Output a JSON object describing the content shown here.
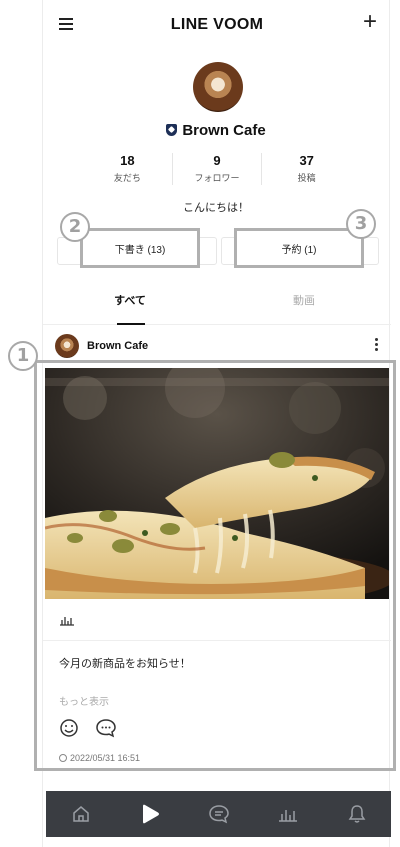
{
  "header": {
    "title": "LINE VOOM",
    "menu_icon": "hamburger-menu-icon",
    "plus_icon": "plus-icon"
  },
  "profile": {
    "name": "Brown Cafe",
    "stats": [
      {
        "value": "18",
        "label": "友だち"
      },
      {
        "value": "9",
        "label": "フォロワー"
      },
      {
        "value": "37",
        "label": "投稿"
      }
    ],
    "greeting": "こんにちは！"
  },
  "actions": {
    "drafts_label": "下書き (13)",
    "scheduled_label": "予約 (1)"
  },
  "tabs": {
    "all_label": "すべて",
    "video_label": "動画"
  },
  "post": {
    "author": "Brown Cafe",
    "text": "今月の新商品をお知らせ！",
    "more_link": "もっと表示",
    "date": "2022/05/31 16:51"
  },
  "bottom_nav": [
    "home-icon",
    "voom-play-icon",
    "chat-icon",
    "insights-icon",
    "notification-bell-icon"
  ],
  "annotations": {
    "n1": "1",
    "n2": "2",
    "n3": "3"
  },
  "colors": {
    "nav_bg": "#3a3d42",
    "annotation_gray": "#b0b0b0",
    "shield": "#1d2f57"
  }
}
